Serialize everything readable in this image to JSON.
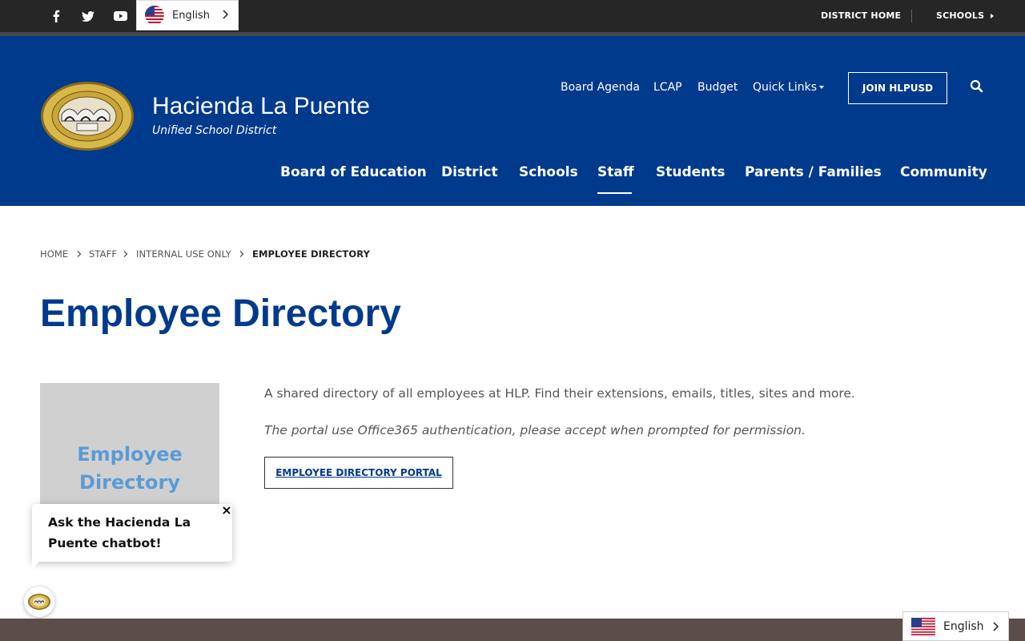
{
  "topbar": {
    "social": [
      {
        "icon": "facebook-icon"
      },
      {
        "icon": "twitter-icon"
      },
      {
        "icon": "youtube-icon"
      }
    ],
    "language": {
      "label": "English",
      "icon": "us-flag-icon"
    },
    "links": {
      "district_home": "DISTRICT HOME",
      "schools": "SCHOOLS"
    }
  },
  "header": {
    "title": "Hacienda La Puente",
    "subtitle": "Unified School District",
    "logo_icon": "district-seal-logo",
    "quick_links": {
      "board_agenda": "Board Agenda",
      "lcap": "LCAP",
      "budget": "Budget",
      "quick_links": "Quick Links"
    },
    "join_button": "JOIN HLPUSD",
    "search_icon": "search-icon",
    "nav": {
      "board": "Board of Education",
      "district": "District",
      "schools": "Schools",
      "staff": "Staff",
      "students": "Students",
      "parents": "Parents / Families",
      "community": "Community"
    },
    "active_nav": "Staff"
  },
  "breadcrumb": {
    "home": "HOME",
    "staff": "STAFF",
    "internal": "INTERNAL USE ONLY",
    "current": "EMPLOYEE DIRECTORY"
  },
  "page": {
    "title": "Employee Directory",
    "thumb_line1": "Employee",
    "thumb_line2": "Directory",
    "description": "A shared directory of all employees at HLP. Find their extensions, emails, titles, sites and more.",
    "note": "The portal use Office365 authentication, please accept when prompted for permission.",
    "portal_button": "EMPLOYEE DIRECTORY PORTAL"
  },
  "chatbot": {
    "message": "Ask the Hacienda La Puente chatbot!",
    "close_symbol": "×"
  },
  "bottom_language": {
    "label": "English"
  },
  "colors": {
    "brand_blue": "#003a8c",
    "topbar": "#262626",
    "thumb_bg": "#d0d0d0",
    "thumb_text": "#5b9bd5",
    "footer": "#5a4d4a"
  }
}
